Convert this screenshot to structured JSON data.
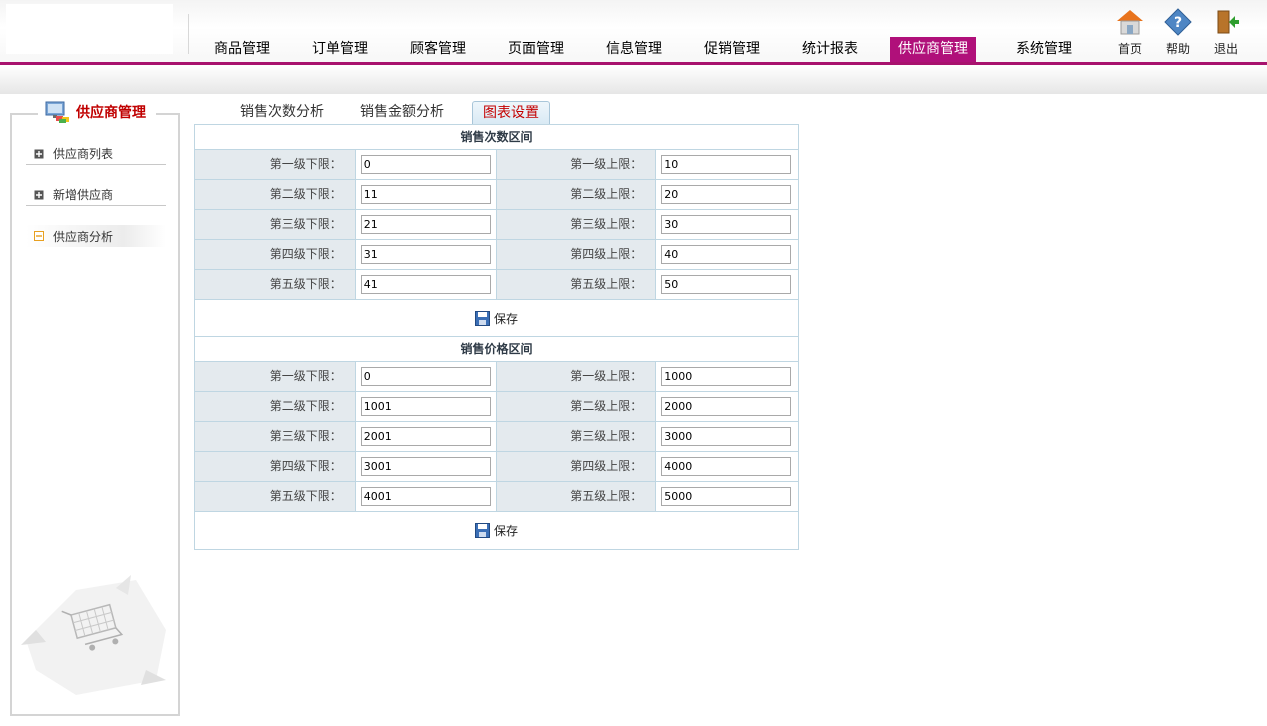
{
  "nav": {
    "items": [
      "商品管理",
      "订单管理",
      "顾客管理",
      "页面管理",
      "信息管理",
      "促销管理",
      "统计报表",
      "供应商管理",
      "系统管理"
    ],
    "active_index": 7
  },
  "top_icons": {
    "home": "首页",
    "help": "帮助",
    "logout": "退出"
  },
  "sidebar": {
    "title": "供应商管理",
    "items": [
      "供应商列表",
      "新增供应商",
      "供应商分析"
    ]
  },
  "tabs": [
    "销售次数分析",
    "销售金额分析",
    "图表设置"
  ],
  "sections": [
    {
      "title": "销售次数区间",
      "rows": [
        {
          "lower_label": "第一级下限：",
          "lower": "0",
          "upper_label": "第一级上限：",
          "upper": "10"
        },
        {
          "lower_label": "第二级下限：",
          "lower": "11",
          "upper_label": "第二级上限：",
          "upper": "20"
        },
        {
          "lower_label": "第三级下限：",
          "lower": "21",
          "upper_label": "第三级上限：",
          "upper": "30"
        },
        {
          "lower_label": "第四级下限：",
          "lower": "31",
          "upper_label": "第四级上限：",
          "upper": "40"
        },
        {
          "lower_label": "第五级下限：",
          "lower": "41",
          "upper_label": "第五级上限：",
          "upper": "50"
        }
      ],
      "save_label": "保存"
    },
    {
      "title": "销售价格区间",
      "rows": [
        {
          "lower_label": "第一级下限：",
          "lower": "0",
          "upper_label": "第一级上限：",
          "upper": "1000"
        },
        {
          "lower_label": "第二级下限：",
          "lower": "1001",
          "upper_label": "第二级上限：",
          "upper": "2000"
        },
        {
          "lower_label": "第三级下限：",
          "lower": "2001",
          "upper_label": "第三级上限：",
          "upper": "3000"
        },
        {
          "lower_label": "第四级下限：",
          "lower": "3001",
          "upper_label": "第四级上限：",
          "upper": "4000"
        },
        {
          "lower_label": "第五级下限：",
          "lower": "4001",
          "upper_label": "第五级上限：",
          "upper": "5000"
        }
      ],
      "save_label": "保存"
    }
  ],
  "colors": {
    "accent": "#b0107a",
    "active_tab_text": "#c40000",
    "label_bg": "#e4eaee",
    "border": "#bfd6e2"
  }
}
